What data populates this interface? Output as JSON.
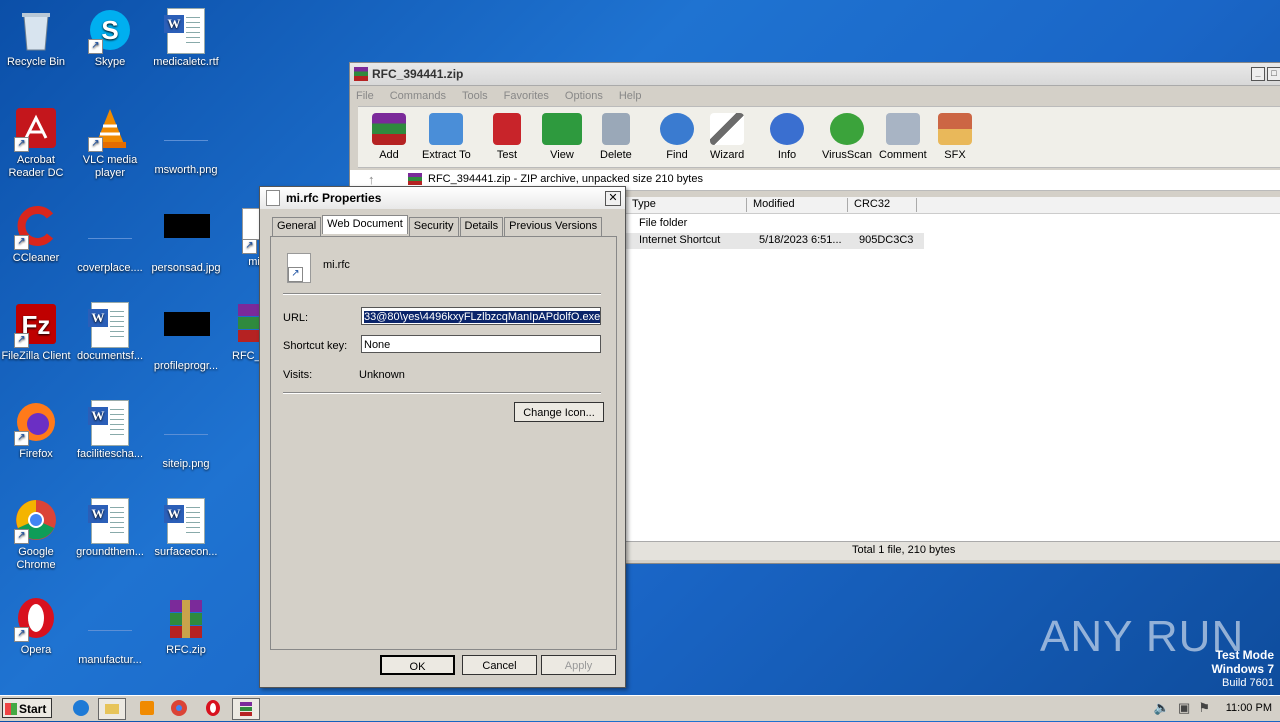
{
  "desktop": {
    "icons": [
      {
        "label": "Recycle Bin",
        "icon": "recycle-bin-icon"
      },
      {
        "label": "Skype",
        "icon": "skype-icon"
      },
      {
        "label": "medicaletc.rtf",
        "icon": "word-document-icon"
      },
      {
        "label": "Acrobat Reader DC",
        "icon": "acrobat-icon"
      },
      {
        "label": "VLC media player",
        "icon": "vlc-icon"
      },
      {
        "label": "msworth.png",
        "icon": "image-file-icon"
      },
      {
        "label": "CCleaner",
        "icon": "ccleaner-icon"
      },
      {
        "label": "coverplace....",
        "icon": "image-file-icon"
      },
      {
        "label": "personsad.jpg",
        "icon": "image-file-icon"
      },
      {
        "label": "mi",
        "icon": "internet-shortcut-icon"
      },
      {
        "label": "FileZilla Client",
        "icon": "filezilla-icon"
      },
      {
        "label": "documentsf...",
        "icon": "word-document-icon"
      },
      {
        "label": "profileprogr...",
        "icon": "image-file-icon"
      },
      {
        "label": "RFC_3",
        "icon": "winrar-archive-icon"
      },
      {
        "label": "Firefox",
        "icon": "firefox-icon"
      },
      {
        "label": "facilitiescha...",
        "icon": "word-document-icon"
      },
      {
        "label": "siteip.png",
        "icon": "image-file-icon"
      },
      {
        "label": "Google Chrome",
        "icon": "chrome-icon"
      },
      {
        "label": "groundthem...",
        "icon": "word-document-icon"
      },
      {
        "label": "surfacecon...",
        "icon": "word-document-icon"
      },
      {
        "label": "Opera",
        "icon": "opera-icon"
      },
      {
        "label": "manufactur...",
        "icon": "image-file-icon"
      },
      {
        "label": "RFC.zip",
        "icon": "winrar-archive-icon"
      }
    ]
  },
  "rar": {
    "title": "RFC_394441.zip",
    "menu": [
      "File",
      "Commands",
      "Tools",
      "Favorites",
      "Options",
      "Help"
    ],
    "toolbar": [
      "Add",
      "Extract To",
      "Test",
      "View",
      "Delete",
      "Find",
      "Wizard",
      "Info",
      "VirusScan",
      "Comment",
      "SFX"
    ],
    "path": "RFC_394441.zip - ZIP archive, unpacked size 210 bytes",
    "columns": [
      "Type",
      "Modified",
      "CRC32"
    ],
    "rows": [
      {
        "type": "File folder",
        "modified": "",
        "crc": ""
      },
      {
        "type": "Internet Shortcut",
        "modified": "5/18/2023 6:51...",
        "crc": "905DC3C3"
      }
    ],
    "status": "Total 1 file, 210 bytes"
  },
  "dialog": {
    "title": "mi.rfc Properties",
    "tabs": [
      "General",
      "Web Document",
      "Security",
      "Details",
      "Previous Versions"
    ],
    "file_name": "mi.rfc",
    "url_label": "URL:",
    "url_value": "33@80\\yes\\4496kxyFLzlbzcqManIpAPdolfO.exe",
    "shortcut_label": "Shortcut key:",
    "shortcut_value": "None",
    "visits_label": "Visits:",
    "visits_value": "Unknown",
    "change_icon": "Change Icon...",
    "ok": "OK",
    "cancel": "Cancel",
    "apply": "Apply"
  },
  "taskbar": {
    "start": "Start",
    "clock": "11:00 PM"
  },
  "watermark": {
    "brand": "ANY RUN",
    "mode": "Test Mode",
    "os": "Windows 7",
    "build": "Build 7601"
  }
}
